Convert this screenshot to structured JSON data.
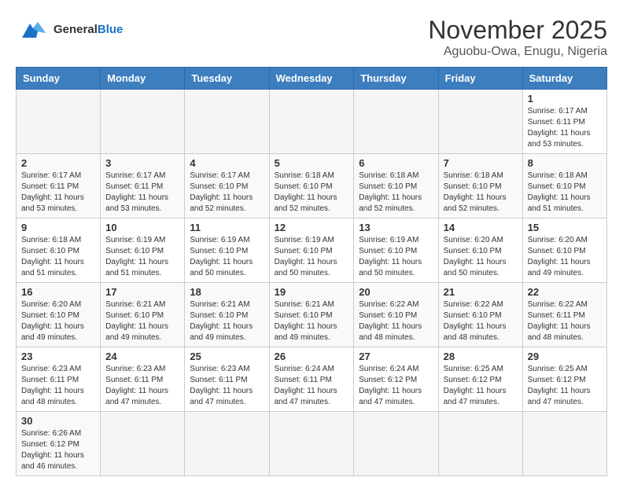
{
  "header": {
    "logo_general": "General",
    "logo_blue": "Blue",
    "month_title": "November 2025",
    "location": "Aguobu-Owa, Enugu, Nigeria"
  },
  "weekdays": [
    "Sunday",
    "Monday",
    "Tuesday",
    "Wednesday",
    "Thursday",
    "Friday",
    "Saturday"
  ],
  "days": {
    "d1": {
      "num": "1",
      "rise": "6:17 AM",
      "set": "6:11 PM",
      "hours": "11 hours and 53 minutes."
    },
    "d2": {
      "num": "2",
      "rise": "6:17 AM",
      "set": "6:11 PM",
      "hours": "11 hours and 53 minutes."
    },
    "d3": {
      "num": "3",
      "rise": "6:17 AM",
      "set": "6:11 PM",
      "hours": "11 hours and 53 minutes."
    },
    "d4": {
      "num": "4",
      "rise": "6:17 AM",
      "set": "6:10 PM",
      "hours": "11 hours and 52 minutes."
    },
    "d5": {
      "num": "5",
      "rise": "6:18 AM",
      "set": "6:10 PM",
      "hours": "11 hours and 52 minutes."
    },
    "d6": {
      "num": "6",
      "rise": "6:18 AM",
      "set": "6:10 PM",
      "hours": "11 hours and 52 minutes."
    },
    "d7": {
      "num": "7",
      "rise": "6:18 AM",
      "set": "6:10 PM",
      "hours": "11 hours and 52 minutes."
    },
    "d8": {
      "num": "8",
      "rise": "6:18 AM",
      "set": "6:10 PM",
      "hours": "11 hours and 51 minutes."
    },
    "d9": {
      "num": "9",
      "rise": "6:18 AM",
      "set": "6:10 PM",
      "hours": "11 hours and 51 minutes."
    },
    "d10": {
      "num": "10",
      "rise": "6:19 AM",
      "set": "6:10 PM",
      "hours": "11 hours and 51 minutes."
    },
    "d11": {
      "num": "11",
      "rise": "6:19 AM",
      "set": "6:10 PM",
      "hours": "11 hours and 50 minutes."
    },
    "d12": {
      "num": "12",
      "rise": "6:19 AM",
      "set": "6:10 PM",
      "hours": "11 hours and 50 minutes."
    },
    "d13": {
      "num": "13",
      "rise": "6:19 AM",
      "set": "6:10 PM",
      "hours": "11 hours and 50 minutes."
    },
    "d14": {
      "num": "14",
      "rise": "6:20 AM",
      "set": "6:10 PM",
      "hours": "11 hours and 50 minutes."
    },
    "d15": {
      "num": "15",
      "rise": "6:20 AM",
      "set": "6:10 PM",
      "hours": "11 hours and 49 minutes."
    },
    "d16": {
      "num": "16",
      "rise": "6:20 AM",
      "set": "6:10 PM",
      "hours": "11 hours and 49 minutes."
    },
    "d17": {
      "num": "17",
      "rise": "6:21 AM",
      "set": "6:10 PM",
      "hours": "11 hours and 49 minutes."
    },
    "d18": {
      "num": "18",
      "rise": "6:21 AM",
      "set": "6:10 PM",
      "hours": "11 hours and 49 minutes."
    },
    "d19": {
      "num": "19",
      "rise": "6:21 AM",
      "set": "6:10 PM",
      "hours": "11 hours and 49 minutes."
    },
    "d20": {
      "num": "20",
      "rise": "6:22 AM",
      "set": "6:10 PM",
      "hours": "11 hours and 48 minutes."
    },
    "d21": {
      "num": "21",
      "rise": "6:22 AM",
      "set": "6:10 PM",
      "hours": "11 hours and 48 minutes."
    },
    "d22": {
      "num": "22",
      "rise": "6:22 AM",
      "set": "6:11 PM",
      "hours": "11 hours and 48 minutes."
    },
    "d23": {
      "num": "23",
      "rise": "6:23 AM",
      "set": "6:11 PM",
      "hours": "11 hours and 48 minutes."
    },
    "d24": {
      "num": "24",
      "rise": "6:23 AM",
      "set": "6:11 PM",
      "hours": "11 hours and 47 minutes."
    },
    "d25": {
      "num": "25",
      "rise": "6:23 AM",
      "set": "6:11 PM",
      "hours": "11 hours and 47 minutes."
    },
    "d26": {
      "num": "26",
      "rise": "6:24 AM",
      "set": "6:11 PM",
      "hours": "11 hours and 47 minutes."
    },
    "d27": {
      "num": "27",
      "rise": "6:24 AM",
      "set": "6:12 PM",
      "hours": "11 hours and 47 minutes."
    },
    "d28": {
      "num": "28",
      "rise": "6:25 AM",
      "set": "6:12 PM",
      "hours": "11 hours and 47 minutes."
    },
    "d29": {
      "num": "29",
      "rise": "6:25 AM",
      "set": "6:12 PM",
      "hours": "11 hours and 47 minutes."
    },
    "d30": {
      "num": "30",
      "rise": "6:26 AM",
      "set": "6:12 PM",
      "hours": "11 hours and 46 minutes."
    }
  },
  "labels": {
    "sunrise": "Sunrise:",
    "sunset": "Sunset:",
    "daylight": "Daylight:"
  }
}
